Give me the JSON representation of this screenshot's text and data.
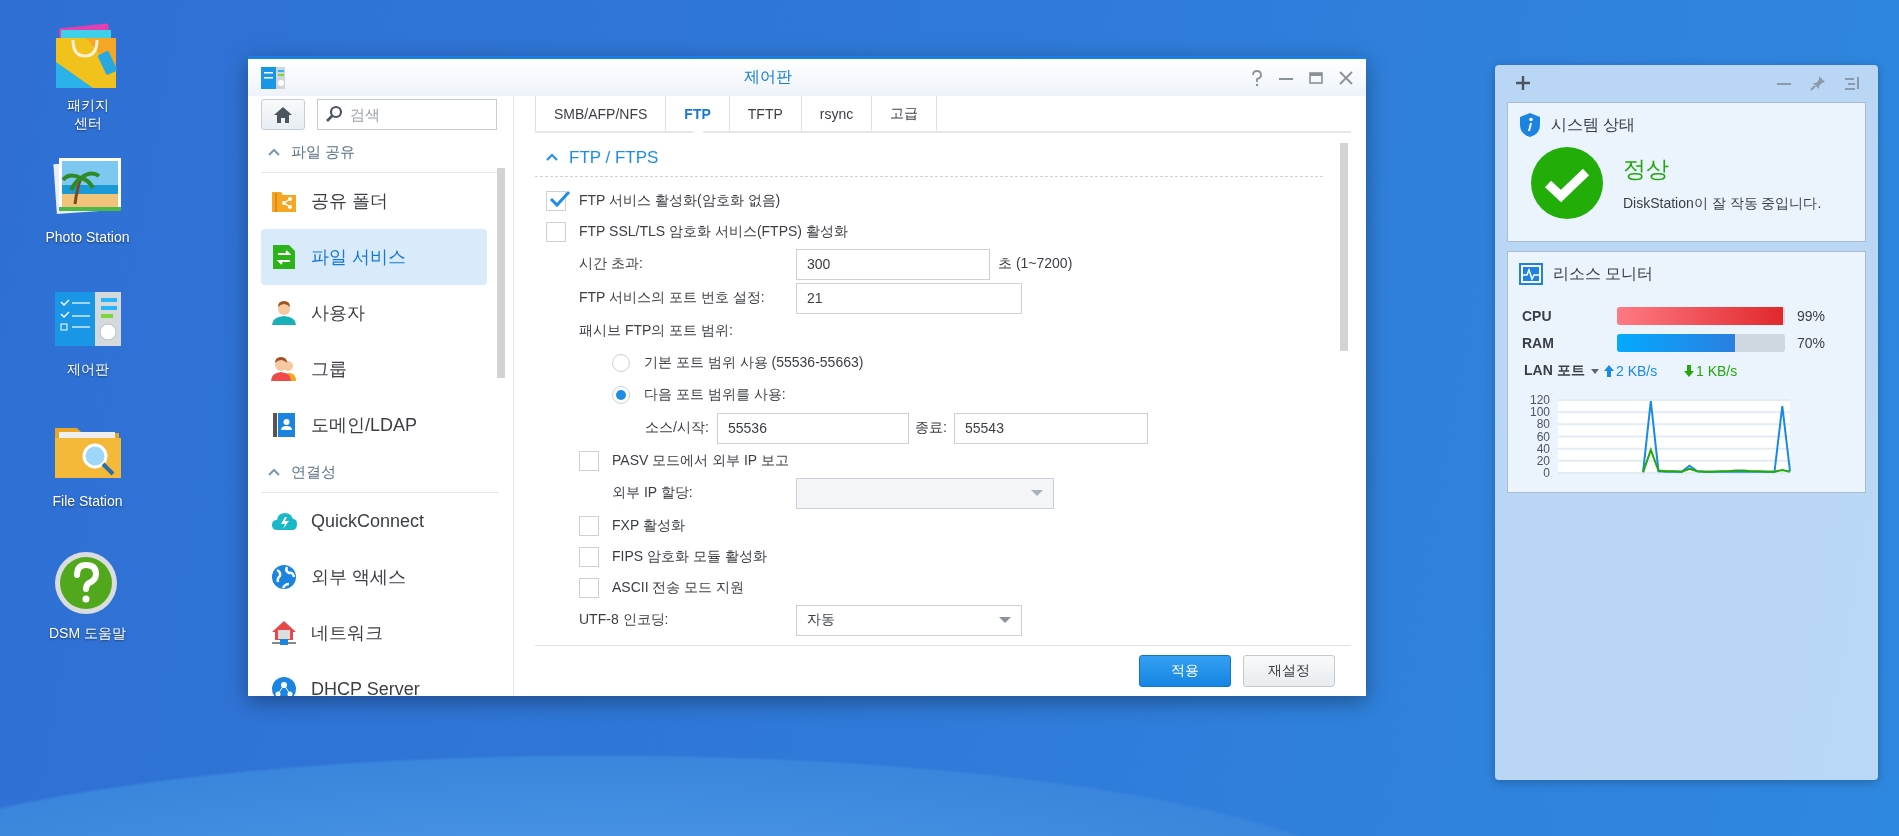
{
  "desktop_icons": [
    {
      "label": "패키지\n센터",
      "kind": "package"
    },
    {
      "label": "Photo Station",
      "kind": "photo"
    },
    {
      "label": "제어판",
      "kind": "control"
    },
    {
      "label": "File Station",
      "kind": "folder"
    },
    {
      "label": "DSM 도움말",
      "kind": "help"
    }
  ],
  "control_panel": {
    "title": "제어판",
    "search": {
      "placeholder": "검색"
    },
    "sidebar": [
      {
        "title": "파일 공유",
        "expanded": true,
        "items": [
          {
            "label": "공유 폴더",
            "kind": "share",
            "selected": false
          },
          {
            "label": "파일 서비스",
            "kind": "files",
            "selected": true
          },
          {
            "label": "사용자",
            "kind": "user",
            "selected": false
          },
          {
            "label": "그룹",
            "kind": "group",
            "selected": false
          },
          {
            "label": "도메인/LDAP",
            "kind": "domain",
            "selected": false
          }
        ]
      },
      {
        "title": "연결성",
        "expanded": true,
        "items": [
          {
            "label": "QuickConnect",
            "kind": "cloud",
            "selected": false
          },
          {
            "label": "외부 액세스",
            "kind": "globe",
            "selected": false
          },
          {
            "label": "네트워크",
            "kind": "house",
            "selected": false
          },
          {
            "label": "DHCP Server",
            "kind": "dhcp",
            "selected": false
          }
        ]
      }
    ],
    "tabs": [
      {
        "label": "SMB/AFP/NFS",
        "selected": false
      },
      {
        "label": "FTP",
        "selected": true
      },
      {
        "label": "TFTP",
        "selected": false
      },
      {
        "label": "rsync",
        "selected": false
      },
      {
        "label": "고급",
        "selected": false
      }
    ],
    "section": {
      "title": "FTP / FTPS",
      "expanded": true,
      "rows": [
        {
          "kind": "checkbox",
          "label": "FTP 서비스 활성화(암호화 없음)",
          "checked": true
        },
        {
          "kind": "checkbox",
          "label": "FTP SSL/TLS 암호화 서비스(FTPS) 활성화",
          "checked": false,
          "children": [
            {
              "kind": "field",
              "label": "시간 초과:",
              "value": "300",
              "suffix": "초 (1~7200)"
            },
            {
              "kind": "field",
              "label": "FTP 서비스의 포트 번호 설정:",
              "value": "21"
            },
            {
              "kind": "label",
              "label": "패시브 FTP의 포트 범위:",
              "children": [
                {
                  "kind": "radio",
                  "label": "기본 포트 범위 사용 (55536-55663)",
                  "selected": false
                },
                {
                  "kind": "radio",
                  "label": "다음 포트 범위를 사용:",
                  "selected": true,
                  "children": [
                    {
                      "kind": "range",
                      "start_label": "소스/시작:",
                      "start_value": "55536",
                      "end_label": "종료:",
                      "end_value": "55543"
                    }
                  ]
                }
              ]
            },
            {
              "kind": "checkbox",
              "label": "PASV 모드에서 외부 IP 보고",
              "checked": false,
              "children": [
                {
                  "kind": "select",
                  "label": "외부 IP 할당:",
                  "disabled": true
                }
              ]
            },
            {
              "kind": "checkbox",
              "label": "FXP 활성화",
              "checked": false
            },
            {
              "kind": "checkbox",
              "label": "FIPS 암호화 모듈 활성화",
              "checked": false
            },
            {
              "kind": "checkbox",
              "label": "ASCII 전송 모드 지원",
              "checked": false
            },
            {
              "kind": "select",
              "label": "UTF-8 인코딩:",
              "value": "자동",
              "disabled": false
            }
          ]
        }
      ]
    },
    "buttons": [
      {
        "label": "적용",
        "kind": "primary"
      },
      {
        "label": "재설정",
        "kind": "default"
      }
    ]
  },
  "widgets": {
    "system_status": {
      "title": "시스템 상태",
      "status": "정상",
      "message": "DiskStation이 잘 작동 중입니다."
    },
    "resource_monitor": {
      "title": "리소스 모니터",
      "meters": [
        {
          "label": "CPU",
          "kind": "cpu",
          "level": 0.99,
          "reading": "99%"
        },
        {
          "label": "RAM",
          "kind": "ram",
          "level": 0.7,
          "reading": "70%"
        }
      ],
      "network": {
        "label": "LAN 포트",
        "upload": "2 KB/s",
        "download": "1 KB/s"
      },
      "chart_data": {
        "type": "line",
        "grid": true,
        "ylim": [
          0,
          120
        ],
        "yticks": [
          0,
          20,
          40,
          60,
          80,
          100,
          120
        ],
        "series": [
          {
            "color": "#1a8ae6",
            "values": [
              null,
              null,
              null,
              null,
              null,
              null,
              null,
              null,
              null,
              null,
              null,
              2,
              118,
              3,
              2,
              2,
              2,
              12,
              3,
              2,
              2,
              2,
              2,
              2,
              2,
              2,
              2,
              2,
              2,
              110,
              3
            ]
          },
          {
            "color": "#24a80a",
            "values": [
              null,
              null,
              null,
              null,
              null,
              null,
              null,
              null,
              null,
              null,
              null,
              1,
              38,
              4,
              3,
              3,
              2,
              7,
              3,
              2,
              2,
              3,
              3,
              4,
              4,
              3,
              3,
              2,
              2,
              5,
              2
            ]
          }
        ]
      }
    }
  }
}
